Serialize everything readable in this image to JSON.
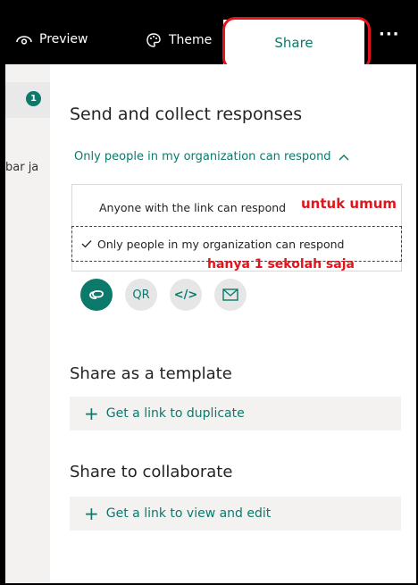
{
  "topbar": {
    "preview_label": "Preview",
    "theme_label": "Theme",
    "share_label": "Share",
    "more_label": "···"
  },
  "left": {
    "step_number": "1",
    "partial_text": "bar ja"
  },
  "panel": {
    "title": "Send and collect responses",
    "dropdown_label": "Only people in my organization can respond",
    "options": [
      "Anyone with the link can respond",
      "Only people in my organization can respond"
    ],
    "icons": [
      "link-icon",
      "qr-icon",
      "embed-icon",
      "email-icon"
    ],
    "qr_label": "QR",
    "embed_label": "</>",
    "template_heading": "Share as a template",
    "template_link": "Get a link to duplicate",
    "collab_heading": "Share to collaborate",
    "collab_link": "Get a link to view and edit"
  },
  "annotations": {
    "umum": "untuk umum",
    "sekolah": "hanya 1 sekolah saja"
  },
  "colors": {
    "accent": "#0b7a6b",
    "annotation_red": "#e2141c"
  }
}
